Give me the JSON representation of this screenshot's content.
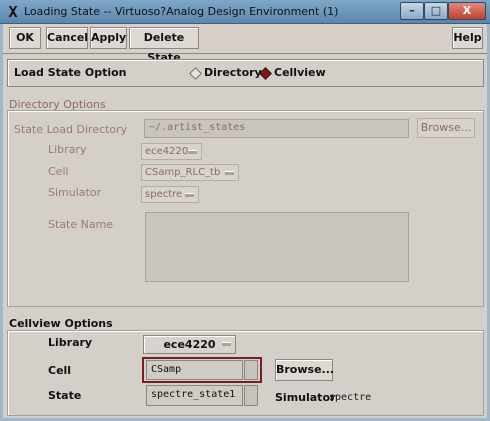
{
  "window": {
    "title": "Loading State -- Virtuoso?Analog Design Environment (1)",
    "app_glyph": "X",
    "minimize_glyph": "–",
    "maximize_glyph": "□",
    "close_glyph": "X"
  },
  "toolbar": {
    "ok": "OK",
    "cancel": "Cancel",
    "apply": "Apply",
    "delete_state": "Delete State",
    "help": "Help"
  },
  "load_state_option": {
    "label": "Load State Option",
    "options": [
      "Directory",
      "Cellview"
    ],
    "selected": "Cellview"
  },
  "directory_options": {
    "title": "Directory Options",
    "state_load_directory_label": "State Load Directory",
    "state_load_directory_value": "~/.artist_states",
    "browse": "Browse...",
    "library_label": "Library",
    "library_value": "ece4220",
    "cell_label": "Cell",
    "cell_value": "CSamp_RLC_tb",
    "simulator_label": "Simulator",
    "simulator_value": "spectre",
    "state_name_label": "State Name"
  },
  "cellview_options": {
    "title": "Cellview Options",
    "library_label": "Library",
    "library_value": "ece4220",
    "cell_label": "Cell",
    "cell_value": "CSamp",
    "browse": "Browse...",
    "state_label": "State",
    "state_value": "spectre_state1",
    "simulator_label": "Simulator",
    "simulator_value": "spectre"
  },
  "colors": {
    "dialog_bg": "#d4cfc9",
    "title_bar": "#6f99bd",
    "close_button": "#c9513d",
    "selected_radio": "#7b1a1a",
    "disabled_text": "#8c6b6b"
  }
}
